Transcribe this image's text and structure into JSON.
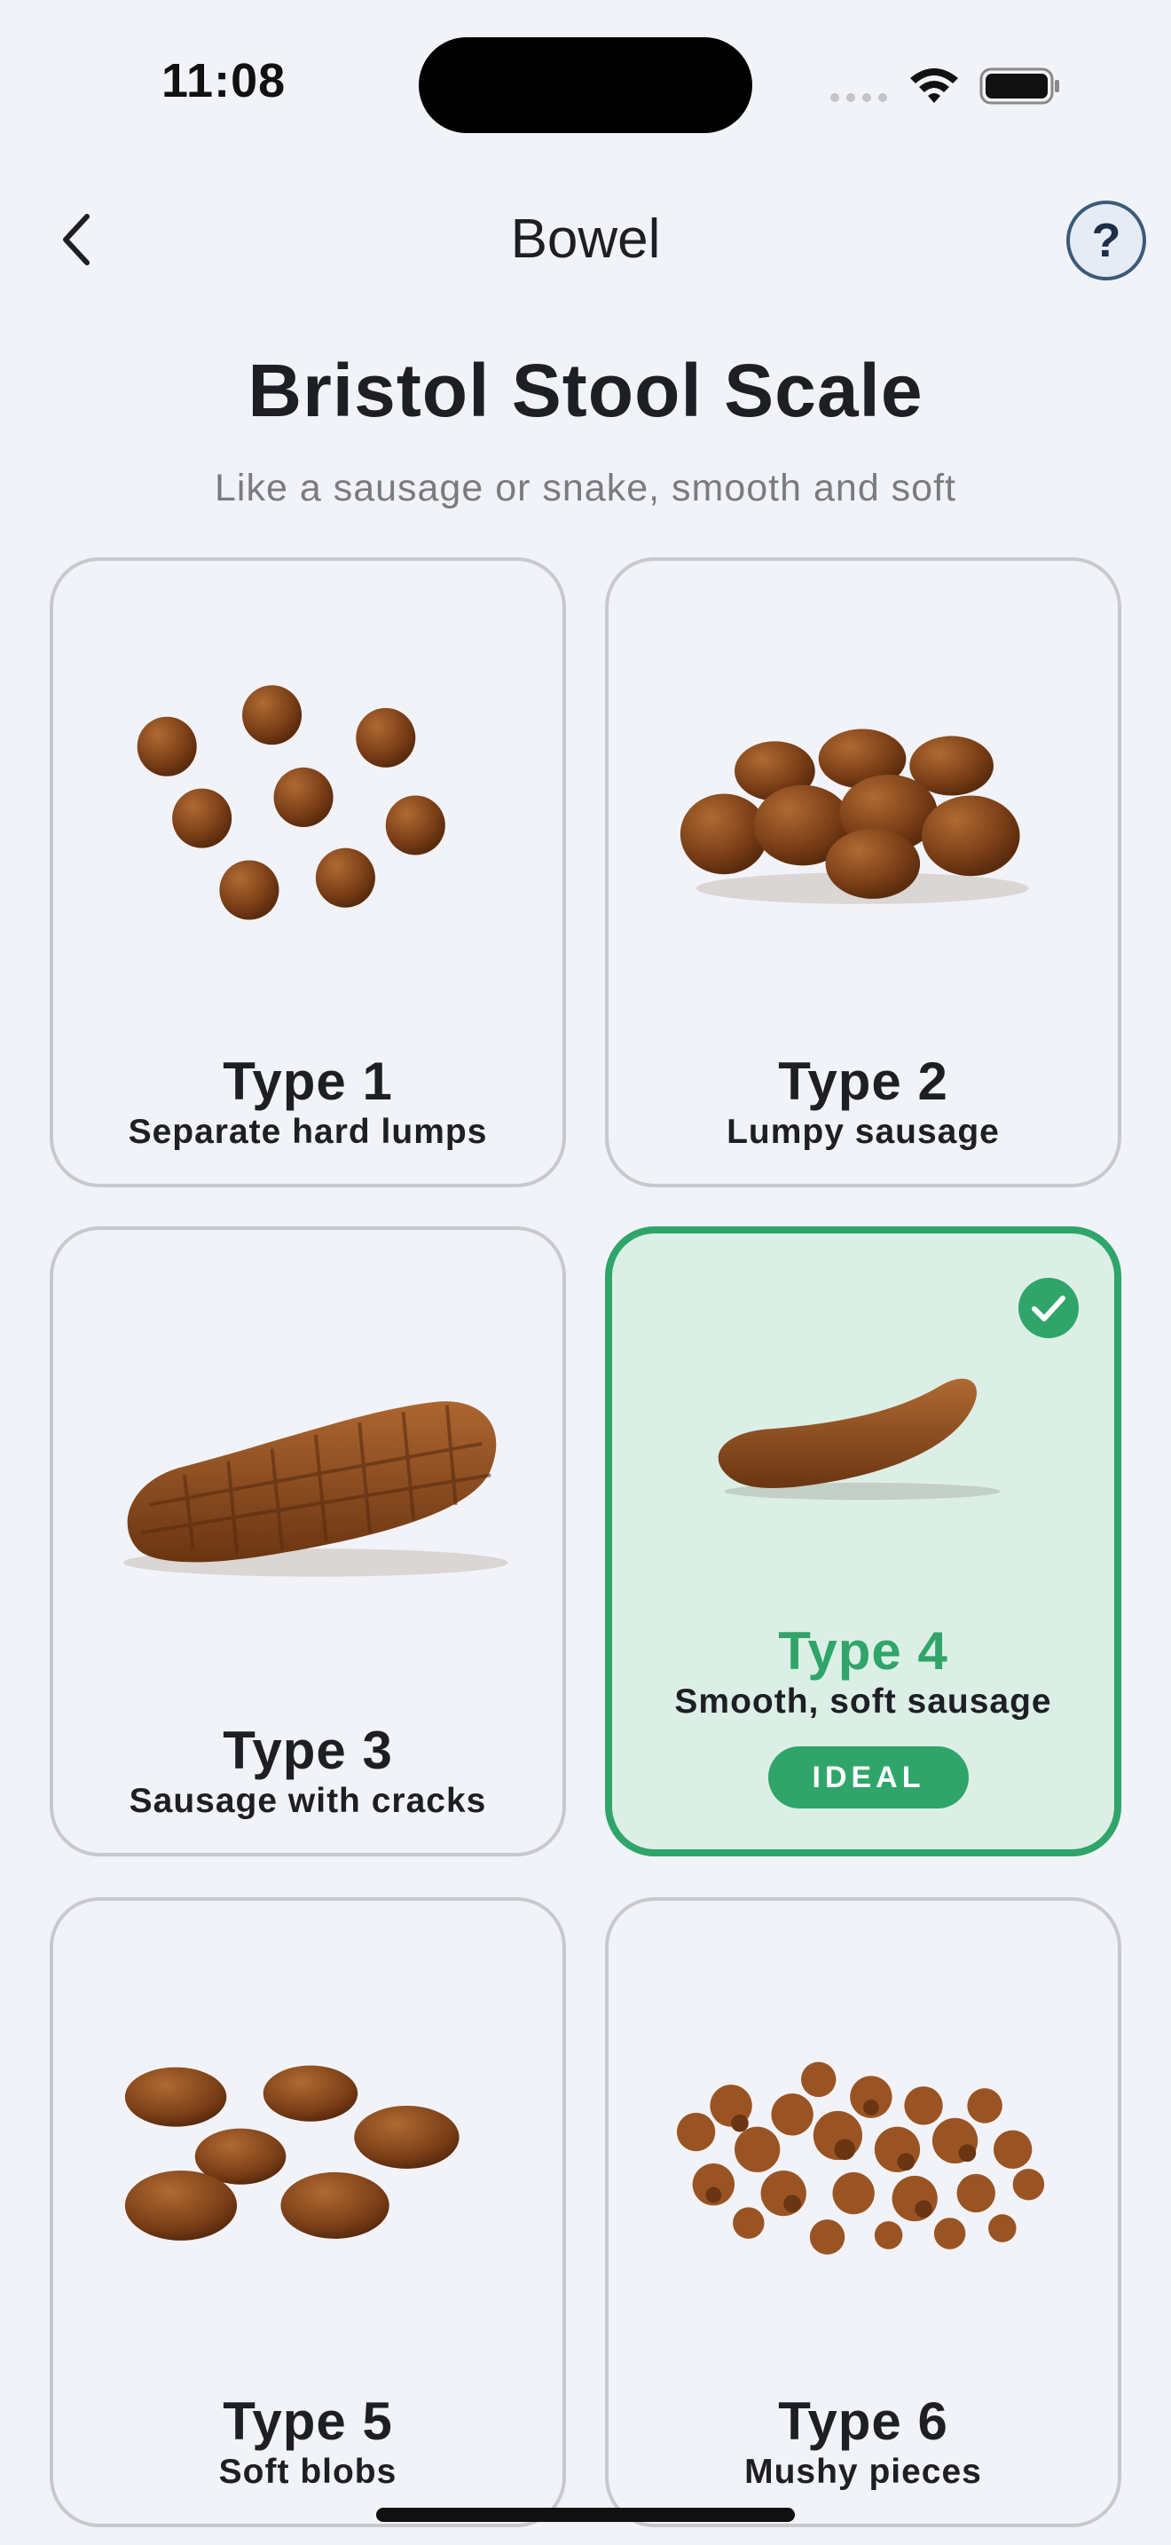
{
  "status_bar": {
    "time": "11:08",
    "icons": [
      "signal-dots-icon",
      "wifi-icon",
      "battery-icon"
    ]
  },
  "nav": {
    "back_icon": "chevron-left-icon",
    "title": "Bowel",
    "help_label": "?"
  },
  "header": {
    "title": "Bristol Stool Scale",
    "subtitle": "Like a sausage or snake, smooth and soft"
  },
  "colors": {
    "accent": "#2fa56a",
    "stool": "#8a4a1c",
    "background": "#f2f3f8",
    "help_border": "#3c5a7a"
  },
  "cards": [
    {
      "type": "Type 1",
      "desc": "Separate hard lumps",
      "selected": false
    },
    {
      "type": "Type 2",
      "desc": "Lumpy sausage",
      "selected": false
    },
    {
      "type": "Type 3",
      "desc": "Sausage with cracks",
      "selected": false
    },
    {
      "type": "Type 4",
      "desc": "Smooth, soft sausage",
      "selected": true,
      "badge": "IDEAL"
    },
    {
      "type": "Type 5",
      "desc": "Soft blobs",
      "selected": false
    },
    {
      "type": "Type 6",
      "desc": "Mushy pieces",
      "selected": false
    }
  ]
}
